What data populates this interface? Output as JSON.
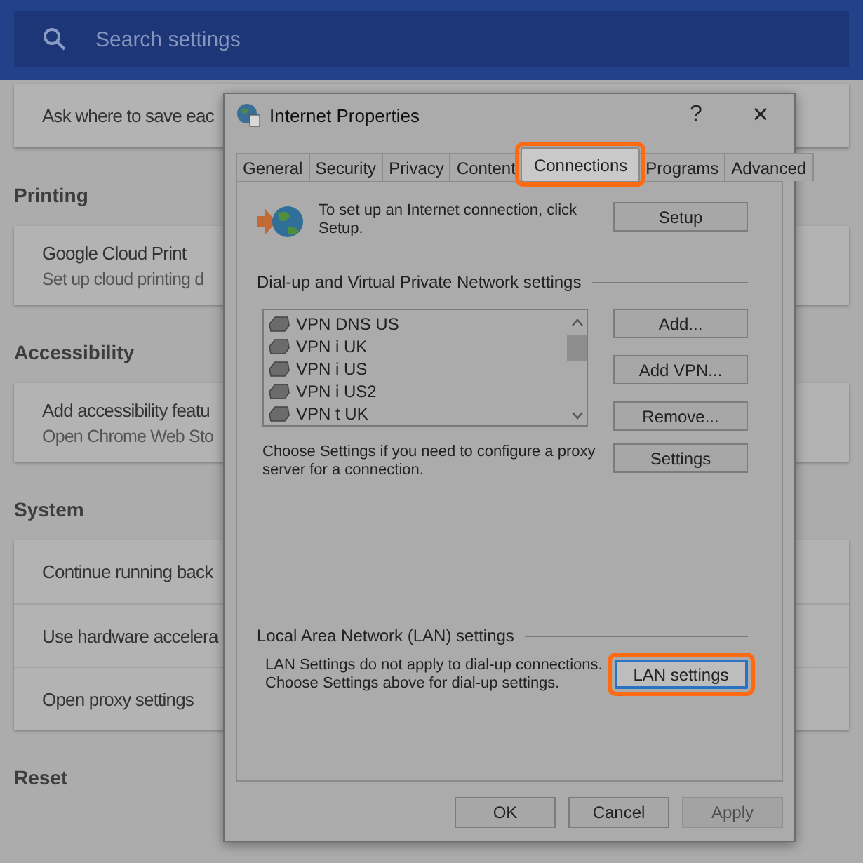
{
  "search": {
    "placeholder": "Search settings"
  },
  "settings": [
    {
      "rows": [
        {
          "title": "Ask where to save eac"
        }
      ]
    },
    {
      "heading": "Printing",
      "rows": [
        {
          "title": "Google Cloud Print",
          "subtitle": "Set up cloud printing d"
        }
      ]
    },
    {
      "heading": "Accessibility",
      "rows": [
        {
          "title": "Add accessibility featu",
          "subtitle": "Open Chrome Web Sto"
        }
      ]
    },
    {
      "heading": "System",
      "rows": [
        {
          "title": "Continue running back"
        },
        {
          "title": "Use hardware accelera"
        },
        {
          "title": "Open proxy settings"
        }
      ]
    },
    {
      "heading": "Reset"
    }
  ],
  "dialog": {
    "title": "Internet Properties",
    "help": "?",
    "close": "×",
    "tabs": [
      {
        "label": "General",
        "selected": false,
        "highlighted": false
      },
      {
        "label": "Security",
        "selected": false,
        "highlighted": false
      },
      {
        "label": "Privacy",
        "selected": false,
        "highlighted": false
      },
      {
        "label": "Content",
        "selected": false,
        "highlighted": false
      },
      {
        "label": "Connections",
        "selected": true,
        "highlighted": true
      },
      {
        "label": "Programs",
        "selected": false,
        "highlighted": false
      },
      {
        "label": "Advanced",
        "selected": false,
        "highlighted": false
      }
    ],
    "setup_text": "To set up an Internet connection, click Setup.",
    "setup_button": "Setup",
    "vpn_group": "Dial-up and Virtual Private Network settings",
    "connections": [
      "VPN DNS US",
      "VPN i UK",
      "VPN i US",
      "VPN i US2",
      "VPN t UK"
    ],
    "side_buttons": [
      "Add...",
      "Add VPN...",
      "Remove..."
    ],
    "proxy_text": "Choose Settings if you need to configure a proxy server for a connection.",
    "settings_button": "Settings",
    "lan_group": "Local Area Network (LAN) settings",
    "lan_text": "LAN Settings do not apply to dial-up connections. Choose Settings above for dial-up settings.",
    "lan_button": {
      "label": "LAN settings",
      "highlighted": true
    },
    "footer_buttons": [
      {
        "label": "OK",
        "disabled": false
      },
      {
        "label": "Cancel",
        "disabled": false
      },
      {
        "label": "Apply",
        "disabled": true
      }
    ]
  }
}
